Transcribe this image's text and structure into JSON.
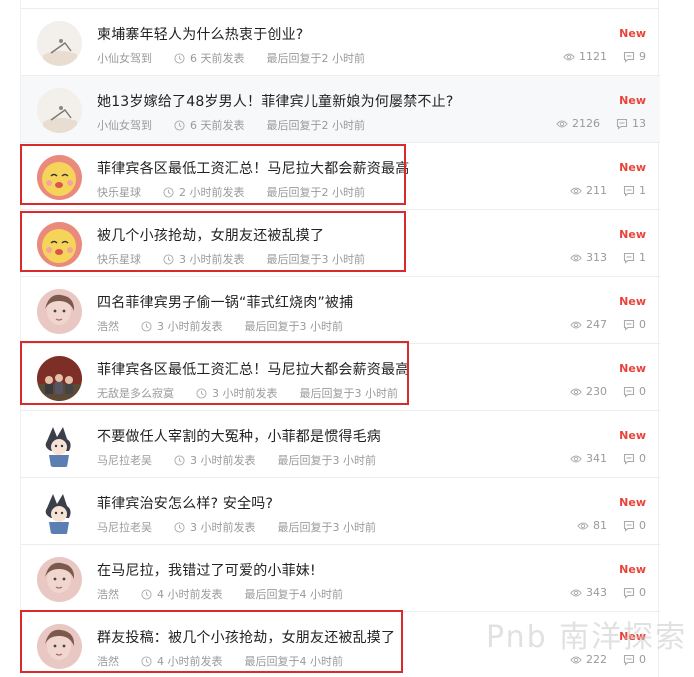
{
  "posts": [
    {
      "title": "柬埔寨年轻人为什么热衷于创业?",
      "author": "小仙女驾到",
      "posted": "6 天前发表",
      "last_reply": "最后回复于2 小时前",
      "badge": "New",
      "views": "1121",
      "replies": "9",
      "avatar": "sketch-avatar",
      "highlighted": false
    },
    {
      "title": "她13岁嫁给了48岁男人！菲律宾儿童新娘为何屡禁不止?",
      "author": "小仙女驾到",
      "posted": "6 天前发表",
      "last_reply": "最后回复于2 小时前",
      "badge": "New",
      "views": "2126",
      "replies": "13",
      "avatar": "sketch-avatar",
      "highlighted": true
    },
    {
      "title": "菲律宾各区最低工资汇总！马尼拉大都会薪资最高",
      "author": "快乐星球",
      "posted": "2 小时前发表",
      "last_reply": "最后回复于2 小时前",
      "badge": "New",
      "views": "211",
      "replies": "1",
      "avatar": "cartoon-face-avatar",
      "highlighted": false
    },
    {
      "title": "被几个小孩抢劫，女朋友还被乱摸了",
      "author": "快乐星球",
      "posted": "3 小时前发表",
      "last_reply": "最后回复于3 小时前",
      "badge": "New",
      "views": "313",
      "replies": "1",
      "avatar": "cartoon-face-avatar",
      "highlighted": false
    },
    {
      "title": "四名菲律宾男子偷一锅“菲式红烧肉”被捕",
      "author": "浩然",
      "posted": "3 小时前发表",
      "last_reply": "最后回复于3 小时前",
      "badge": "New",
      "views": "247",
      "replies": "0",
      "avatar": "portrait-avatar",
      "highlighted": false
    },
    {
      "title": "菲律宾各区最低工资汇总！马尼拉大都会薪资最高",
      "author": "无敌是多么寂寞",
      "posted": "3 小时前发表",
      "last_reply": "最后回复于3 小时前",
      "badge": "New",
      "views": "230",
      "replies": "0",
      "avatar": "group-photo-avatar",
      "highlighted": false
    },
    {
      "title": "不要做任人宰割的大冤种，小菲都是惯得毛病",
      "author": "马尼拉老吴",
      "posted": "3 小时前发表",
      "last_reply": "最后回复于3 小时前",
      "badge": "New",
      "views": "341",
      "replies": "0",
      "avatar": "anime-avatar",
      "highlighted": false
    },
    {
      "title": "菲律宾治安怎么样? 安全吗?",
      "author": "马尼拉老吴",
      "posted": "3 小时前发表",
      "last_reply": "最后回复于3 小时前",
      "badge": "New",
      "views": "81",
      "replies": "0",
      "avatar": "anime-avatar",
      "highlighted": false
    },
    {
      "title": "在马尼拉，我错过了可爱的小菲妹!",
      "author": "浩然",
      "posted": "4 小时前发表",
      "last_reply": "最后回复于4 小时前",
      "badge": "New",
      "views": "343",
      "replies": "0",
      "avatar": "portrait-avatar",
      "highlighted": false
    },
    {
      "title": "群友投稿：被几个小孩抢劫，女朋友还被乱摸了",
      "author": "浩然",
      "posted": "4 小时前发表",
      "last_reply": "最后回复于4 小时前",
      "badge": "New",
      "views": "222",
      "replies": "0",
      "avatar": "portrait-avatar",
      "highlighted": false
    }
  ],
  "colors": {
    "badge": "#e8443a",
    "annotation_box": "#d92b2b",
    "meta": "#9a9a9a"
  },
  "icons": {
    "posted": "clock-icon",
    "views": "eye-icon",
    "replies": "comment-icon"
  }
}
